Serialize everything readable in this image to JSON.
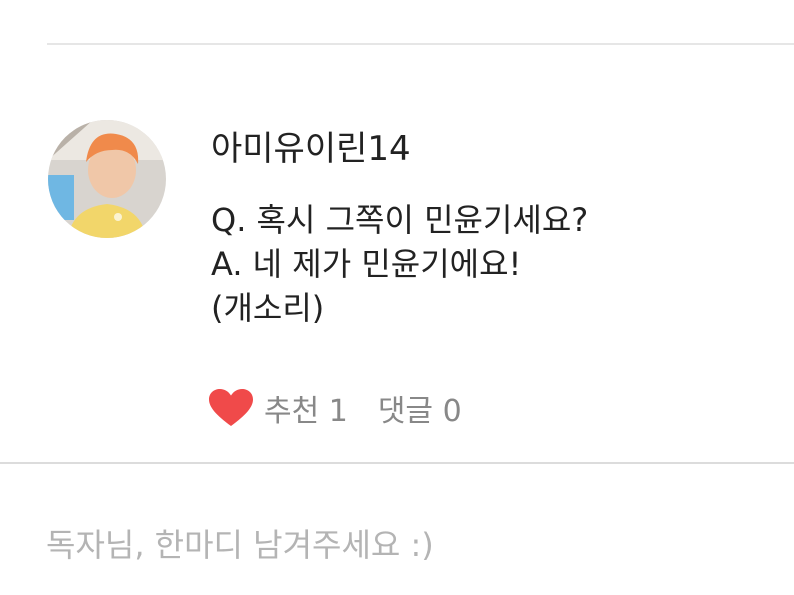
{
  "comment": {
    "author": "아미유이린14",
    "lines": [
      "Q. 혹시 그쪽이 민윤기세요?",
      "A. 네 제가 민윤기에요!",
      "(개소리)"
    ],
    "recommend_label": "추천 1",
    "comment_count_label": "댓글 0",
    "heart_color": "#f04a4a"
  },
  "reply": {
    "placeholder": "독자님, 한마디 남겨주세요 :)"
  },
  "colors": {
    "text": "#222222",
    "muted": "#888888",
    "placeholder": "#b4b4b4",
    "divider": "#dcdcdc"
  }
}
